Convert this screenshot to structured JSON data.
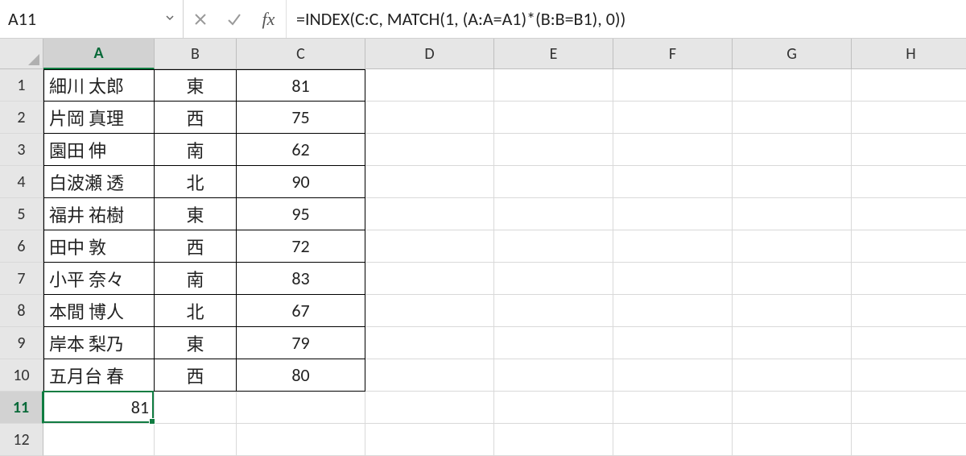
{
  "formula_bar": {
    "name_box": "A11",
    "fx_label": "fx",
    "formula": "=INDEX(C:C, MATCH(1, (A:A=A1)*(B:B=B1), 0))"
  },
  "columns": [
    "A",
    "B",
    "C",
    "D",
    "E",
    "F",
    "G",
    "H"
  ],
  "column_widths": {
    "A": 138,
    "B": 102,
    "C": 160,
    "D": 160,
    "E": 148,
    "F": 148,
    "G": 148,
    "H": 148
  },
  "row_count": 12,
  "active_cell": {
    "col": "A",
    "row": 11,
    "value": "81"
  },
  "chart_data": {
    "type": "table",
    "columns": [
      "A",
      "B",
      "C"
    ],
    "rows": [
      {
        "A": "細川 太郎",
        "B": "東",
        "C": 81
      },
      {
        "A": "片岡 真理",
        "B": "西",
        "C": 75
      },
      {
        "A": "園田 伸",
        "B": "南",
        "C": 62
      },
      {
        "A": "白波瀬 透",
        "B": "北",
        "C": 90
      },
      {
        "A": "福井 祐樹",
        "B": "東",
        "C": 95
      },
      {
        "A": "田中 敦",
        "B": "西",
        "C": 72
      },
      {
        "A": "小平 奈々",
        "B": "南",
        "C": 83
      },
      {
        "A": "本間 博人",
        "B": "北",
        "C": 67
      },
      {
        "A": "岸本 梨乃",
        "B": "東",
        "C": 79
      },
      {
        "A": "五月台 春",
        "B": "西",
        "C": 80
      }
    ]
  }
}
